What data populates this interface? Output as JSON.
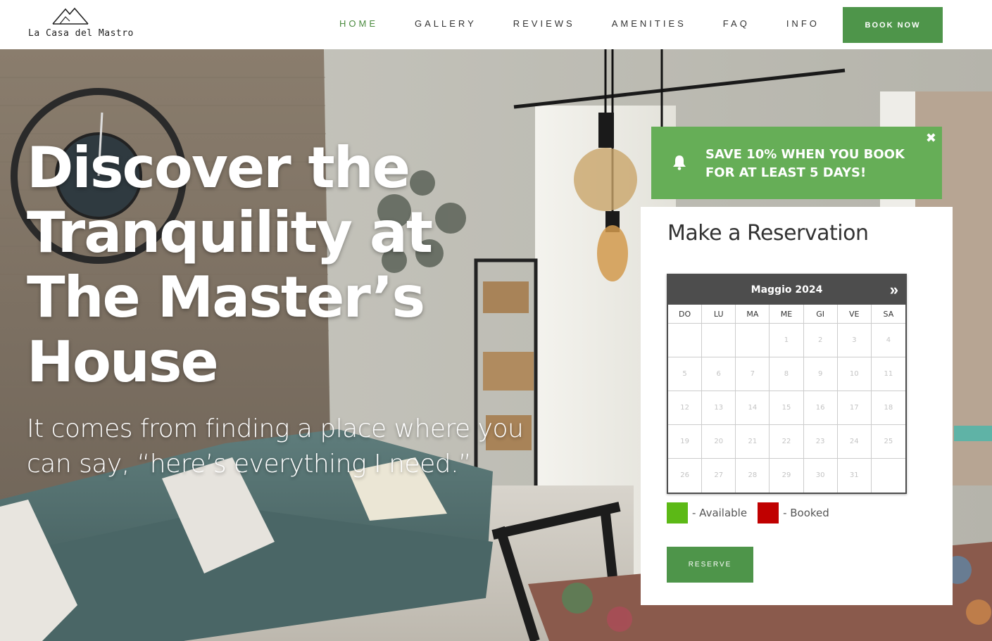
{
  "brand": {
    "logo_text": "La Casa del Mastro",
    "logo_icon": "house-roof-icon"
  },
  "nav": {
    "items": [
      {
        "label": "HOME",
        "active": true
      },
      {
        "label": "GALLERY",
        "active": false
      },
      {
        "label": "REVIEWS",
        "active": false
      },
      {
        "label": "AMENITIES",
        "active": false
      },
      {
        "label": "FAQ",
        "active": false
      },
      {
        "label": "INFO",
        "active": false
      }
    ],
    "book_button": "BOOK NOW"
  },
  "hero": {
    "title": "Discover the Tranquility at The Master’s House",
    "subtitle": "It comes from finding a place where you can say, “here’s everything I need.”"
  },
  "promo": {
    "text": "SAVE 10% WHEN YOU BOOK FOR AT LEAST 5 DAYS!",
    "icon": "bell-icon",
    "close_symbol": "✖"
  },
  "reservation": {
    "title": "Make a Reservation",
    "calendar": {
      "month_label": "Maggio 2024",
      "next_symbol": "»",
      "weekdays": [
        "DO",
        "LU",
        "MA",
        "ME",
        "GI",
        "VE",
        "SA"
      ],
      "weeks": [
        [
          "",
          "",
          "",
          "1",
          "2",
          "3",
          "4"
        ],
        [
          "5",
          "6",
          "7",
          "8",
          "9",
          "10",
          "11"
        ],
        [
          "12",
          "13",
          "14",
          "15",
          "16",
          "17",
          "18"
        ],
        [
          "19",
          "20",
          "21",
          "22",
          "23",
          "24",
          "25"
        ],
        [
          "26",
          "27",
          "28",
          "29",
          "30",
          "31",
          ""
        ]
      ]
    },
    "legend": [
      {
        "label": "- Available",
        "color": "#5cb916"
      },
      {
        "label": "- Booked",
        "color": "#c00000"
      }
    ],
    "reserve_button": "RESERVE"
  },
  "colors": {
    "accent": "#4e954a",
    "promo_bg": "#66ae57",
    "calendar_header": "#4d4d4d"
  }
}
